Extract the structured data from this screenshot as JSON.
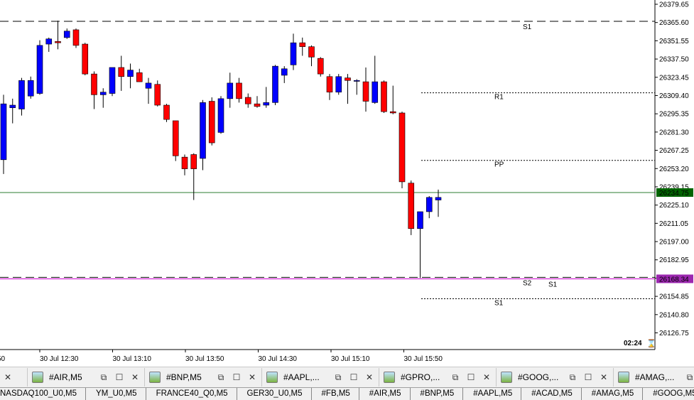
{
  "chart_data": {
    "type": "candlestick",
    "price_axis": {
      "min": 26119.0,
      "max": 26384.0,
      "ticks": [
        "26379.65",
        "26365.60",
        "26351.55",
        "26337.50",
        "26323.45",
        "26309.40",
        "26295.35",
        "26281.30",
        "26267.25",
        "26253.20",
        "26239.15",
        "26225.10",
        "26211.05",
        "26197.00",
        "26182.95",
        "26168.90",
        "26154.85",
        "26140.80",
        "26126.75"
      ]
    },
    "time_axis": {
      "labels": [
        "30 Jul 12:30",
        "30 Jul 13:10",
        "30 Jul 13:50",
        "30 Jul 14:30",
        "30 Jul 15:10",
        "30 Jul 15:50"
      ],
      "first_partial_label": "50"
    },
    "candles": [
      {
        "o": 26260,
        "h": 26310,
        "l": 26249,
        "c": 26303
      },
      {
        "o": 26300,
        "h": 26307,
        "l": 26288,
        "c": 26302
      },
      {
        "o": 26299,
        "h": 26323,
        "l": 26294,
        "c": 26321
      },
      {
        "o": 26309,
        "h": 26324,
        "l": 26307,
        "c": 26321
      },
      {
        "o": 26311,
        "h": 26352,
        "l": 26310,
        "c": 26348
      },
      {
        "o": 26349,
        "h": 26354,
        "l": 26343,
        "c": 26353
      },
      {
        "o": 26351,
        "h": 26367,
        "l": 26345,
        "c": 26350
      },
      {
        "o": 26354,
        "h": 26361,
        "l": 26353,
        "c": 26359
      },
      {
        "o": 26360,
        "h": 26361,
        "l": 26346,
        "c": 26348
      },
      {
        "o": 26349,
        "h": 26350,
        "l": 26325,
        "c": 26326
      },
      {
        "o": 26326,
        "h": 26328,
        "l": 26299,
        "c": 26310
      },
      {
        "o": 26310,
        "h": 26315,
        "l": 26300,
        "c": 26312
      },
      {
        "o": 26311,
        "h": 26331,
        "l": 26309,
        "c": 26331
      },
      {
        "o": 26331,
        "h": 26340,
        "l": 26313,
        "c": 26324
      },
      {
        "o": 26324,
        "h": 26334,
        "l": 26315,
        "c": 26329
      },
      {
        "o": 26327,
        "h": 26330,
        "l": 26320,
        "c": 26320
      },
      {
        "o": 26315,
        "h": 26323,
        "l": 26303,
        "c": 26319
      },
      {
        "o": 26318,
        "h": 26321,
        "l": 26301,
        "c": 26302
      },
      {
        "o": 26302,
        "h": 26303,
        "l": 26289,
        "c": 26291
      },
      {
        "o": 26290,
        "h": 26290,
        "l": 26259,
        "c": 26263
      },
      {
        "o": 26262,
        "h": 26264,
        "l": 26248,
        "c": 26253
      },
      {
        "o": 26264,
        "h": 26265,
        "l": 26229,
        "c": 26253
      },
      {
        "o": 26261,
        "h": 26306,
        "l": 26252,
        "c": 26304
      },
      {
        "o": 26305,
        "h": 26308,
        "l": 26271,
        "c": 26273
      },
      {
        "o": 26281,
        "h": 26309,
        "l": 26280,
        "c": 26307
      },
      {
        "o": 26307,
        "h": 26327,
        "l": 26300,
        "c": 26319
      },
      {
        "o": 26319,
        "h": 26323,
        "l": 26304,
        "c": 26307
      },
      {
        "o": 26308,
        "h": 26311,
        "l": 26300,
        "c": 26303
      },
      {
        "o": 26303,
        "h": 26309,
        "l": 26300,
        "c": 26301
      },
      {
        "o": 26302,
        "h": 26316,
        "l": 26300,
        "c": 26304
      },
      {
        "o": 26304,
        "h": 26333,
        "l": 26302,
        "c": 26332
      },
      {
        "o": 26325,
        "h": 26332,
        "l": 26319,
        "c": 26330
      },
      {
        "o": 26333,
        "h": 26357,
        "l": 26329,
        "c": 26350
      },
      {
        "o": 26350,
        "h": 26354,
        "l": 26340,
        "c": 26347
      },
      {
        "o": 26347,
        "h": 26348,
        "l": 26332,
        "c": 26339
      },
      {
        "o": 26338,
        "h": 26339,
        "l": 26324,
        "c": 26326
      },
      {
        "o": 26324,
        "h": 26326,
        "l": 26306,
        "c": 26312
      },
      {
        "o": 26312,
        "h": 26326,
        "l": 26310,
        "c": 26324
      },
      {
        "o": 26323,
        "h": 26326,
        "l": 26303,
        "c": 26321
      },
      {
        "o": 26321,
        "h": 26322,
        "l": 26310,
        "c": 26321
      },
      {
        "o": 26320,
        "h": 26331,
        "l": 26297,
        "c": 26305
      },
      {
        "o": 26304,
        "h": 26340,
        "l": 26303,
        "c": 26320
      },
      {
        "o": 26320,
        "h": 26321,
        "l": 26296,
        "c": 26297
      },
      {
        "o": 26297,
        "h": 26317,
        "l": 26295,
        "c": 26296
      },
      {
        "o": 26296,
        "h": 26297,
        "l": 26238,
        "c": 26243
      },
      {
        "o": 26242,
        "h": 26244,
        "l": 26202,
        "c": 26207
      },
      {
        "o": 26207,
        "h": 26218,
        "l": 26169,
        "c": 26220
      },
      {
        "o": 26220,
        "h": 26232,
        "l": 26215,
        "c": 26231
      },
      {
        "o": 26229,
        "h": 26237,
        "l": 26216,
        "c": 26231
      }
    ],
    "horizontal_lines": [
      {
        "label": "S1",
        "price": 26366.5,
        "style": "long-dash",
        "color": "#000000",
        "label_position": "right"
      },
      {
        "label": "R1",
        "price": 26311.5,
        "style": "dotted",
        "color": "#000000",
        "label_position": "right"
      },
      {
        "label": "PP",
        "price": 26259.5,
        "style": "dotted",
        "color": "#000000",
        "label_position": "right"
      },
      {
        "label": "S2",
        "price": 26169.5,
        "style": "long-dash",
        "color": "#000000",
        "label_position": "right"
      },
      {
        "label": "S1",
        "price": 26153.0,
        "style": "dotted",
        "color": "#000000",
        "label_position": "right"
      },
      {
        "label": "S1",
        "price": 26168.34,
        "style": "solid",
        "color": "#cc00cc",
        "label_position": "right"
      },
      {
        "label": "",
        "price": 26234.75,
        "style": "solid",
        "color": "#2e7d32",
        "label_position": "none"
      }
    ],
    "markers": {
      "current_price": {
        "value": "26234.75",
        "color": "#006400"
      },
      "magenta_price": {
        "value": "26168.34",
        "color": "#9c27b0"
      }
    },
    "colors": {
      "bull": "#0000ff",
      "bear": "#ff0000",
      "wick": "#000000"
    }
  },
  "timer": {
    "value": "02:24"
  },
  "window_tabs": [
    {
      "label": ""
    },
    {
      "label": "#AIR,M5"
    },
    {
      "label": "#BNP,M5"
    },
    {
      "label": "#AAPL,..."
    },
    {
      "label": "#GPRO,..."
    },
    {
      "label": "#GOOG,..."
    },
    {
      "label": "#AMAG,..."
    }
  ],
  "symbol_tabs": [
    "NASDAQ100_U0,M5",
    "YM_U0,M5",
    "FRANCE40_Q0,M5",
    "GER30_U0,M5",
    "#FB,M5",
    "#AIR,M5",
    "#BNP,M5",
    "#AAPL,M5",
    "#ACAD,M5",
    "#AMAG,M5",
    "#GOOG,M5",
    "#G"
  ]
}
